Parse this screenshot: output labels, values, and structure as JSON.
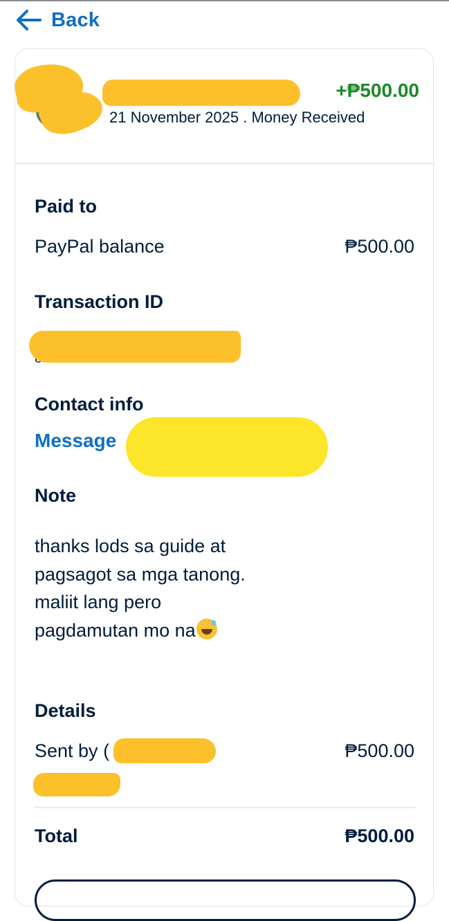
{
  "nav": {
    "back_label": "Back"
  },
  "header": {
    "amount": "+₱500.00",
    "subtitle": "21 November 2025 . Money Received"
  },
  "paid_to": {
    "title": "Paid to",
    "method": "PayPal balance",
    "amount": "₱500.00"
  },
  "transaction": {
    "title": "Transaction ID",
    "id_visible_fragment": "8 0 D"
  },
  "contact": {
    "title": "Contact info",
    "message_label": "Message"
  },
  "note": {
    "title": "Note",
    "text": "thanks lods sa guide at pagsagot sa mga tanong. maliit lang pero pagdamutan mo na"
  },
  "details": {
    "title": "Details",
    "sent_by_label": "Sent by",
    "sent_by_visible_fragment": "(",
    "amount": "₱500.00"
  },
  "total": {
    "label": "Total",
    "amount": "₱500.00"
  },
  "colors": {
    "link_blue": "#0f6ec5",
    "received_green": "#1a8a26",
    "text_navy": "#001c3d",
    "redaction_yellow": "#fcc02b"
  },
  "icons": [
    "arrow-left-icon",
    "grinning-sweat-emoji-icon"
  ]
}
